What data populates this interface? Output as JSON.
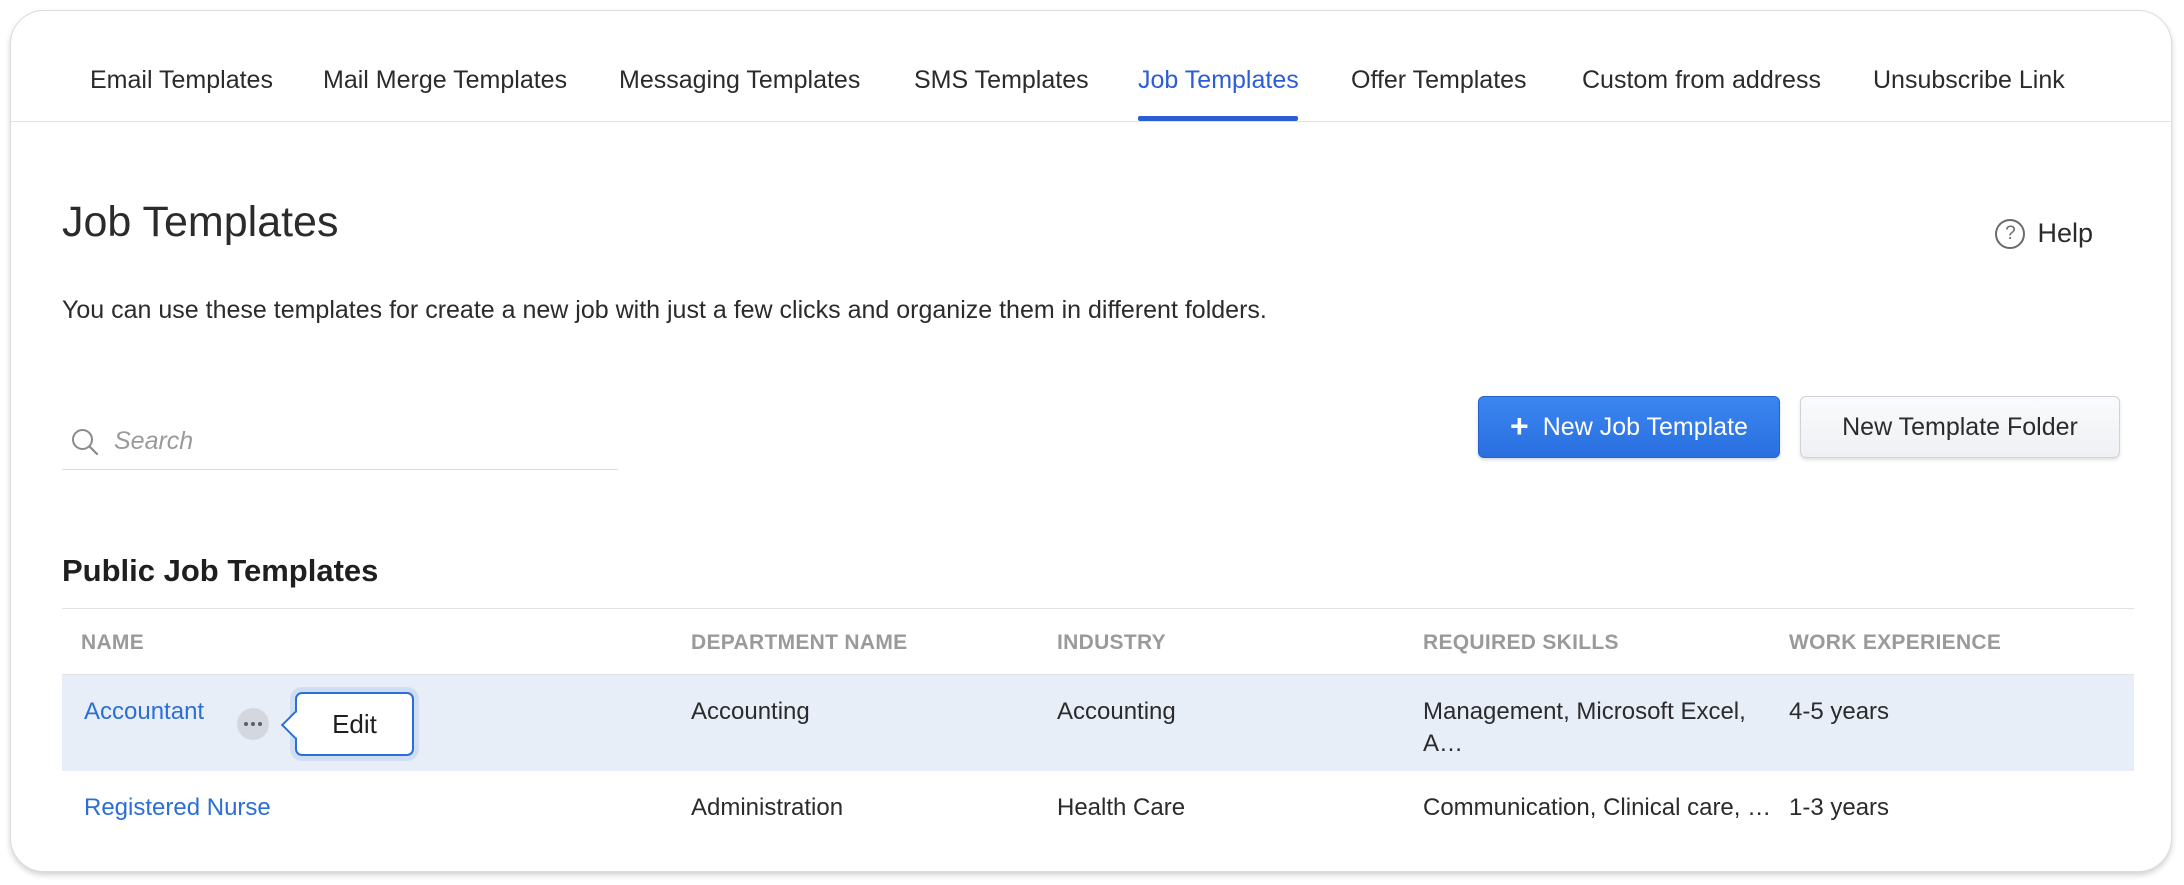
{
  "tabs": [
    {
      "label": "Email Templates"
    },
    {
      "label": "Mail Merge Templates"
    },
    {
      "label": "Messaging Templates"
    },
    {
      "label": "SMS Templates"
    },
    {
      "label": "Job Templates"
    },
    {
      "label": "Offer Templates"
    },
    {
      "label": "Custom from address"
    },
    {
      "label": "Unsubscribe Link"
    }
  ],
  "active_tab": "Job Templates",
  "page": {
    "title": "Job Templates",
    "description": "You can use these templates for create a new job with just a few clicks and organize them in different folders.",
    "help_label": "Help",
    "help_icon": "?"
  },
  "search": {
    "placeholder": "Search",
    "value": ""
  },
  "buttons": {
    "new_job_template": "New Job Template",
    "new_job_template_icon": "+",
    "new_template_folder": "New Template Folder"
  },
  "section": {
    "title": "Public Job Templates"
  },
  "table": {
    "headers": [
      "NAME",
      "DEPARTMENT NAME",
      "INDUSTRY",
      "REQUIRED SKILLS",
      "WORK EXPERIENCE"
    ],
    "rows": [
      {
        "name": "Accountant",
        "department": "Accounting",
        "industry": "Accounting",
        "skills": "Management, Microsoft Excel, A…",
        "experience": "4-5 years"
      },
      {
        "name": "Registered Nurse",
        "department": "Administration",
        "industry": "Health Care",
        "skills": "Communication, Clinical care, …",
        "experience": "1-3 years"
      }
    ]
  },
  "row_menu": {
    "edit_label": "Edit"
  },
  "colors": {
    "accent": "#2b5ed6",
    "link": "#2b6fd6",
    "primary_button": "#2a6fe0",
    "row_highlight": "#e8eef8",
    "header_text": "#9a9a9a"
  }
}
